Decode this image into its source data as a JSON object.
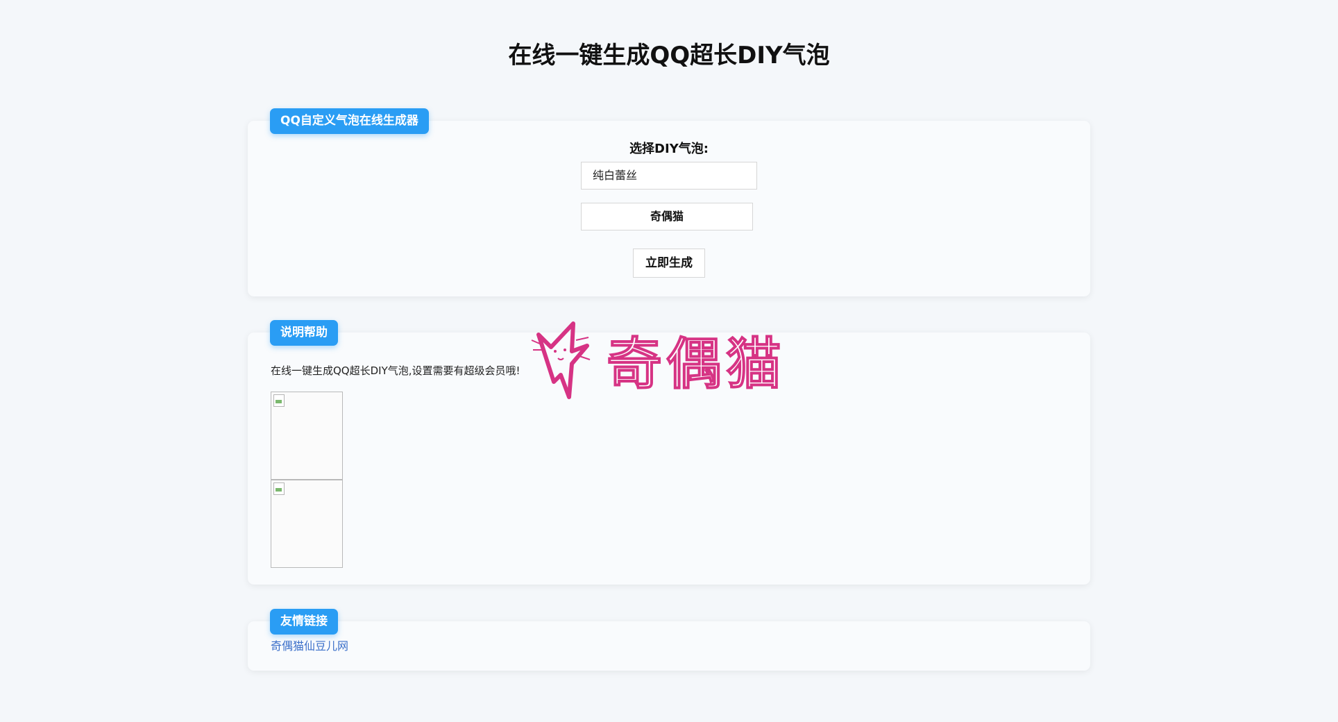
{
  "page": {
    "title": "在线一键生成QQ超长DIY气泡"
  },
  "generator": {
    "tag": "QQ自定义气泡在线生成器",
    "select_label": "选择DIY气泡:",
    "selected_bubble": "纯白蕾丝",
    "name_value": "奇偶猫",
    "generate_button": "立即生成"
  },
  "help": {
    "tag": "说明帮助",
    "text": "在线一键生成QQ超长DIY气泡,设置需要有超级会员哦!"
  },
  "links": {
    "tag": "友情链接",
    "items": [
      {
        "label": "奇偶猫仙豆儿网"
      }
    ]
  },
  "watermark": {
    "text": "奇偶猫",
    "color": "#d63384"
  },
  "colors": {
    "accent": "#2a9df4",
    "link": "#3b6fc9",
    "background": "#f4f7fa",
    "card": "#f9fbfd"
  }
}
